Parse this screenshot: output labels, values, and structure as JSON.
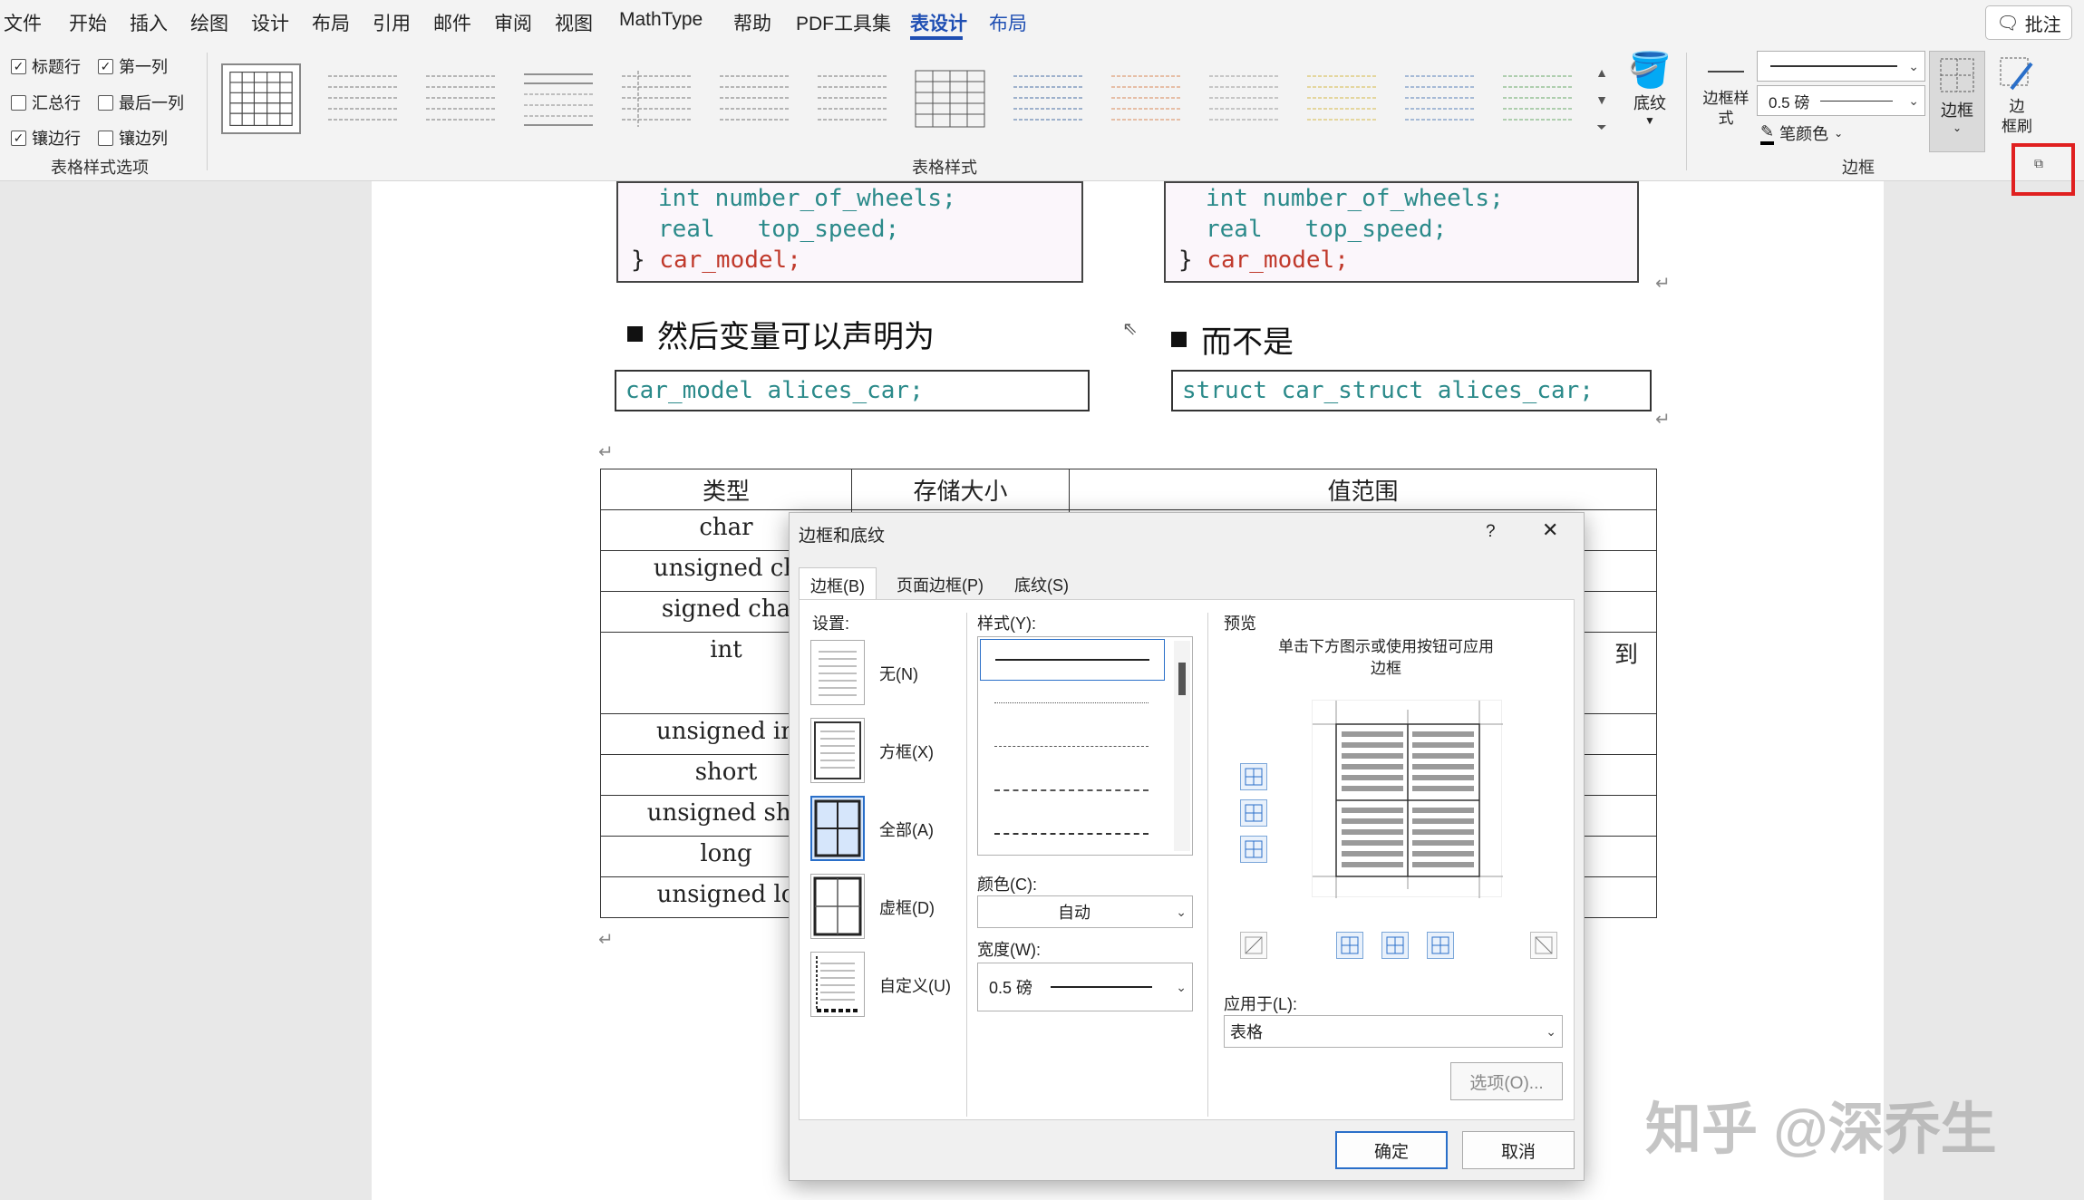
{
  "menubar": {
    "items": [
      "文件",
      "开始",
      "插入",
      "绘图",
      "设计",
      "布局",
      "引用",
      "邮件",
      "审阅",
      "视图",
      "MathType",
      "帮助",
      "PDF工具集",
      "表设计",
      "布局"
    ],
    "active_index": 13,
    "comment_label": "批注"
  },
  "ribbon": {
    "table_options": {
      "items": [
        {
          "label": "标题行",
          "checked": true
        },
        {
          "label": "第一列",
          "checked": true
        },
        {
          "label": "汇总行",
          "checked": false
        },
        {
          "label": "最后一列",
          "checked": false
        },
        {
          "label": "镶边行",
          "checked": true
        },
        {
          "label": "镶边列",
          "checked": false
        }
      ],
      "group_label": "表格样式选项"
    },
    "table_styles": {
      "group_label": "表格样式"
    },
    "shading_label": "底纹",
    "borders": {
      "border_styles_label": "边框样\n式",
      "weight": "0.5 磅",
      "pen_color_label": "笔颜色",
      "borders_label": "边框",
      "border_painter_label": "边\n框刷",
      "group_label": "边框"
    }
  },
  "document": {
    "code_left": {
      "line1_kw": "int",
      "line1_rest": "number_of_wheels;",
      "line2_kw": "real",
      "line2_rest": "top_speed;",
      "line3_brace": "}",
      "line3_rest": "car_model;"
    },
    "code_right": {
      "line1_kw": "int",
      "line1_rest": "number_of_wheels;",
      "line2_kw": "real",
      "line2_rest": "top_speed;",
      "line3_brace": "}",
      "line3_rest": "car_model;"
    },
    "heading_left": "然后变量可以声明为",
    "heading_right": "而不是",
    "snippet_left": "car_model alices_car;",
    "snippet_right": "struct car_struct alices_car;",
    "table": {
      "headers": [
        "类型",
        "存储大小",
        "值范围"
      ],
      "rows": [
        "char",
        "unsigned ch",
        "signed cha",
        "int",
        "unsigned in",
        "short",
        "unsigned sho",
        "long",
        "unsigned lo"
      ],
      "partial_text": "到"
    },
    "paragraph_mark": "↵"
  },
  "dialog": {
    "title": "边框和底纹",
    "help": "?",
    "close": "✕",
    "tabs": [
      "边框(B)",
      "页面边框(P)",
      "底纹(S)"
    ],
    "settings_label": "设置:",
    "settings": [
      "无(N)",
      "方框(X)",
      "全部(A)",
      "虚框(D)",
      "自定义(U)"
    ],
    "style_label": "样式(Y):",
    "color_label": "颜色(C):",
    "color_value": "自动",
    "width_label": "宽度(W):",
    "width_value": "0.5 磅",
    "preview_label": "预览",
    "preview_hint": "单击下方图示或使用按钮可应用\n边框",
    "apply_label": "应用于(L):",
    "apply_value": "表格",
    "options_button": "选项(O)...",
    "ok_button": "确定",
    "cancel_button": "取消"
  },
  "watermark": "知乎 @深乔生",
  "colors": {
    "accent": "#1f4fb3",
    "highlight": "#e02020",
    "code_keyword": "#2b8a8a",
    "code_red": "#c0392b"
  }
}
